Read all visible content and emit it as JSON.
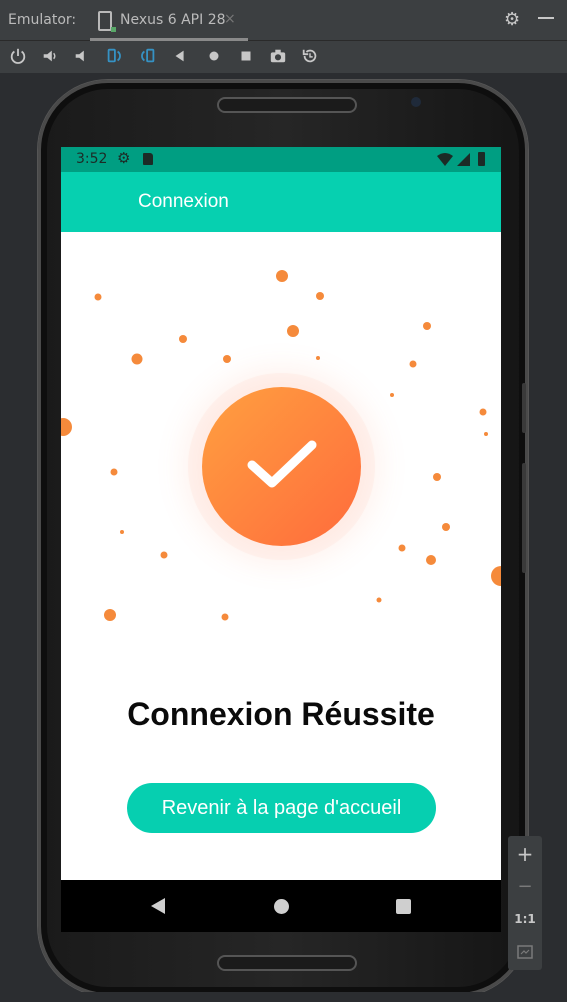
{
  "emulator": {
    "label": "Emulator:",
    "tab_title": "Nexus 6 API 28",
    "tab_close": "×",
    "settings_icon": "gear-icon",
    "minimize_icon": "minus-icon"
  },
  "toolbar": {
    "icons": [
      "power-icon",
      "volume-up-icon",
      "volume-down-icon",
      "rotate-left-icon",
      "rotate-right-icon",
      "back-icon",
      "home-icon",
      "overview-icon",
      "camera-icon",
      "snapshot-icon"
    ]
  },
  "status_bar": {
    "time": "3:52",
    "icons": [
      "gear-icon",
      "sd-card-icon",
      "wifi-icon",
      "signal-icon",
      "battery-icon"
    ]
  },
  "app_bar": {
    "title": "Connexion"
  },
  "main": {
    "success_title": "Connexion Réussite",
    "home_button_label": "Revenir à la page d'accueil",
    "check_icon": "checkmark-icon",
    "accent_color": "#ff7a3d",
    "brand_color": "#06d0b0"
  },
  "zoom": {
    "plus": "+",
    "minus": "−",
    "one_to_one": "1:1"
  }
}
